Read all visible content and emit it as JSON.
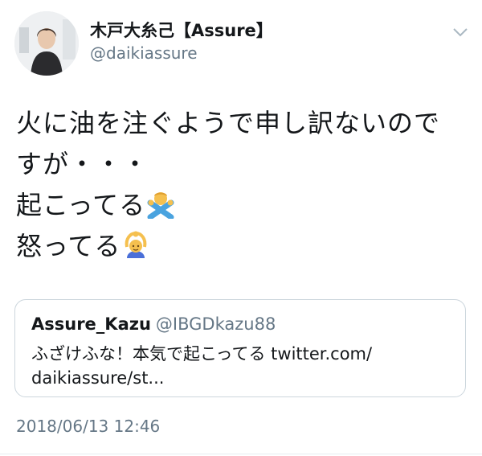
{
  "author": {
    "display_name": "木戸大糸己【Assure】",
    "handle": "@daikiassure",
    "avatar_icon": "user-avatar"
  },
  "menu": {
    "icon": "chevron-down-icon",
    "color": "#aab8c2"
  },
  "tweet": {
    "lines": [
      "火に油を注ぐようで申し訳ないので",
      "すが・・・",
      "起こってる",
      "怒ってる"
    ],
    "emojis": {
      "line3": "person-gesturing-no-emoji",
      "line4": "person-raising-hands-emoji"
    }
  },
  "quoted_tweet": {
    "name": "Assure_Kazu",
    "handle": "@IBGDkazu88",
    "text_line1": "ふざけふな！本気で起こってる twitter.com/",
    "text_line2": "daikiassure/st..."
  },
  "timestamp": "2018/06/13 12:46",
  "colors": {
    "text": "#14171a",
    "secondary": "#657786",
    "border": "#ccd6dd"
  }
}
